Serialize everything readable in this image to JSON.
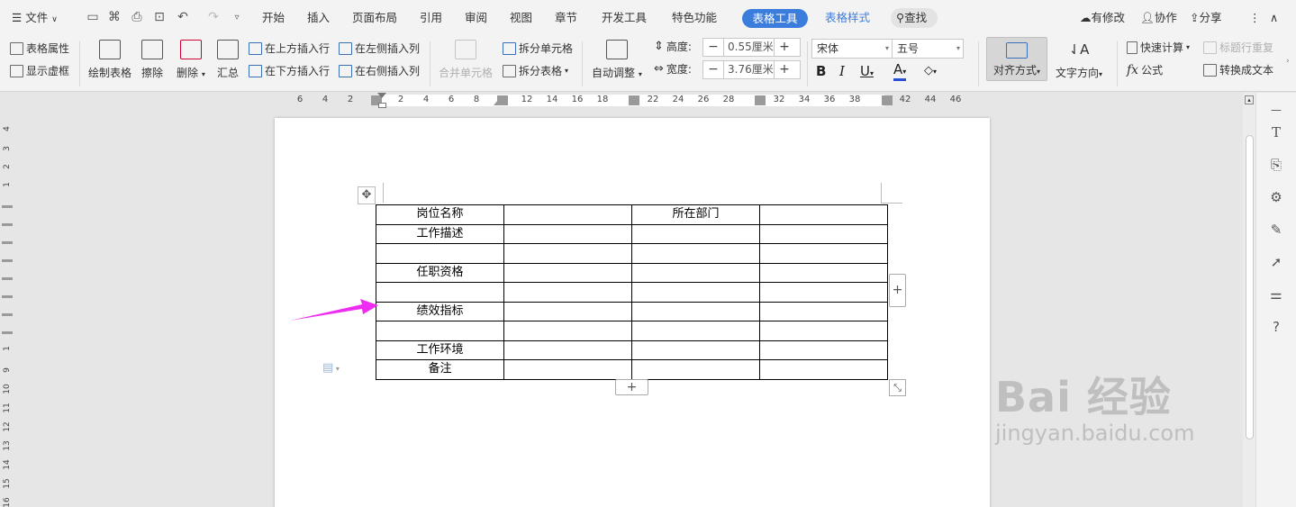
{
  "menu": {
    "file": "文件",
    "tabs": [
      "开始",
      "插入",
      "页面布局",
      "引用",
      "审阅",
      "视图",
      "章节",
      "开发工具",
      "特色功能",
      "表格工具",
      "表格样式"
    ],
    "search": "查找",
    "right": [
      "有修改",
      "协作",
      "分享"
    ]
  },
  "ribbon": {
    "table_properties": "表格属性",
    "show_gridlines": "显示虚框",
    "draw_table": "绘制表格",
    "erase": "擦除",
    "delete": "删除",
    "summary": "汇总",
    "insert_above": "在上方插入行",
    "insert_below": "在下方插入行",
    "insert_left": "在左侧插入列",
    "insert_right": "在右侧插入列",
    "merge_cells": "合并单元格",
    "split_cells": "拆分单元格",
    "split_table": "拆分表格",
    "auto_fit": "自动调整",
    "height_label": "高度:",
    "height_value": "0.55厘米",
    "width_label": "宽度:",
    "width_value": "3.76厘米",
    "font_name": "宋体",
    "font_size": "五号",
    "align": "对齐方式",
    "text_direction": "文字方向",
    "quick_calc": "快速计算",
    "repeat_header": "标题行重复",
    "formula": "公式",
    "convert_text": "转换成文本"
  },
  "ruler": {
    "h_numbers": [
      "6",
      "4",
      "2",
      "2",
      "4",
      "6",
      "8",
      "12",
      "14",
      "16",
      "18",
      "22",
      "24",
      "26",
      "28",
      "32",
      "34",
      "36",
      "38",
      "42",
      "44",
      "46"
    ],
    "v_numbers": [
      "4",
      "3",
      "2",
      "1",
      "1",
      "9",
      "10",
      "11",
      "12",
      "13",
      "14",
      "15",
      "16"
    ]
  },
  "table": {
    "rows": [
      [
        "岗位名称",
        "",
        "所在部门",
        ""
      ],
      [
        "工作描述",
        "",
        "",
        ""
      ],
      [
        "",
        "",
        "",
        ""
      ],
      [
        "任职资格",
        "",
        "",
        ""
      ],
      [
        "",
        "",
        "",
        ""
      ],
      [
        "绩效指标",
        "",
        "",
        ""
      ],
      [
        "",
        "",
        "",
        ""
      ],
      [
        "工作环境",
        "",
        "",
        ""
      ],
      [
        "备注",
        "",
        "",
        ""
      ]
    ]
  },
  "colors": {
    "accent": "#3b7ddd",
    "arrow": "#ee2df0"
  },
  "watermark": {
    "line1": "Bai 经验",
    "line2": "jingyan.baidu.com"
  }
}
